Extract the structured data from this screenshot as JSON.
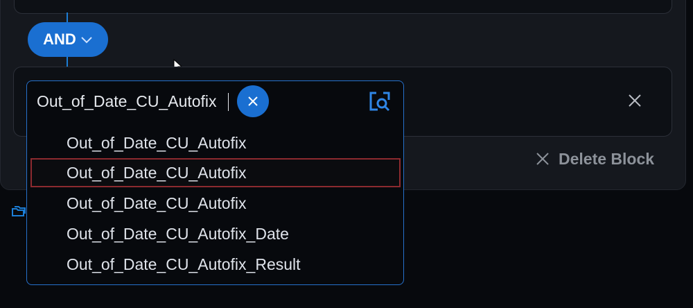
{
  "logic": {
    "operator": "AND"
  },
  "picker": {
    "value": "Out_of_Date_CU_Autofix",
    "options": [
      {
        "label": "Out_of_Date_CU_Autofix"
      },
      {
        "label": "Out_of_Date_CU_Autofix"
      },
      {
        "label": "Out_of_Date_CU_Autofix"
      },
      {
        "label": "Out_of_Date_CU_Autofix_Date"
      },
      {
        "label": "Out_of_Date_CU_Autofix_Result"
      }
    ],
    "highlighted_index": 1
  },
  "block": {
    "delete_label": "Delete Block"
  },
  "icons": {
    "operator": "chevron-down-icon",
    "clear": "close-icon",
    "search": "search-icon",
    "remove": "close-icon",
    "side": "folder-icon"
  },
  "colors": {
    "accent": "#1a6fd1",
    "highlight_border": "#8c2a2f",
    "background": "#07090d",
    "panel": "#15181e"
  }
}
